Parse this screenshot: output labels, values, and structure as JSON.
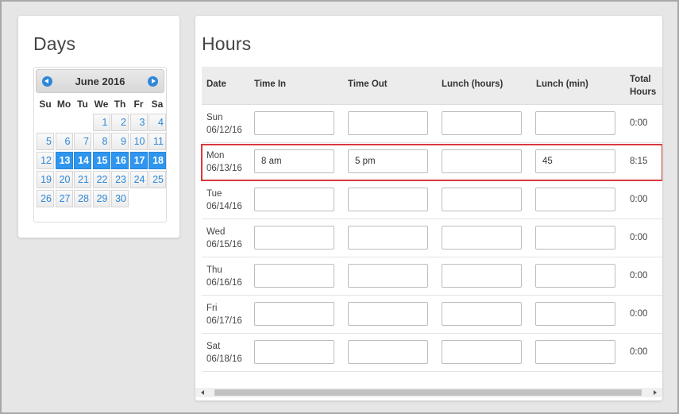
{
  "days_panel": {
    "title": "Days",
    "calendar": {
      "month_label": "June 2016",
      "weekdays": [
        "Su",
        "Mo",
        "Tu",
        "We",
        "Th",
        "Fr",
        "Sa"
      ],
      "leading_blanks": 3,
      "days": [
        "1",
        "2",
        "3",
        "4",
        "5",
        "6",
        "7",
        "8",
        "9",
        "10",
        "11",
        "12",
        "13",
        "14",
        "15",
        "16",
        "17",
        "18",
        "19",
        "20",
        "21",
        "22",
        "23",
        "24",
        "25",
        "26",
        "27",
        "28",
        "29",
        "30"
      ],
      "selected_days": [
        "13",
        "14",
        "15",
        "16",
        "17",
        "18"
      ]
    }
  },
  "hours_panel": {
    "title": "Hours",
    "headers": {
      "date": "Date",
      "time_in": "Time In",
      "time_out": "Time Out",
      "lunch_hours": "Lunch (hours)",
      "lunch_min": "Lunch (min)",
      "total_line1": "Total",
      "total_line2": "Hours"
    },
    "rows": [
      {
        "day": "Sun",
        "date": "06/12/16",
        "time_in": "",
        "time_out": "",
        "lunch_hours": "",
        "lunch_min": "",
        "total": "0:00"
      },
      {
        "day": "Mon",
        "date": "06/13/16",
        "time_in": "8 am",
        "time_out": "5 pm",
        "lunch_hours": "",
        "lunch_min": "45",
        "total": "8:15"
      },
      {
        "day": "Tue",
        "date": "06/14/16",
        "time_in": "",
        "time_out": "",
        "lunch_hours": "",
        "lunch_min": "",
        "total": "0:00"
      },
      {
        "day": "Wed",
        "date": "06/15/16",
        "time_in": "",
        "time_out": "",
        "lunch_hours": "",
        "lunch_min": "",
        "total": "0:00"
      },
      {
        "day": "Thu",
        "date": "06/16/16",
        "time_in": "",
        "time_out": "",
        "lunch_hours": "",
        "lunch_min": "",
        "total": "0:00"
      },
      {
        "day": "Fri",
        "date": "06/17/16",
        "time_in": "",
        "time_out": "",
        "lunch_hours": "",
        "lunch_min": "",
        "total": "0:00"
      },
      {
        "day": "Sat",
        "date": "06/18/16",
        "time_in": "",
        "time_out": "",
        "lunch_hours": "",
        "lunch_min": "",
        "total": "0:00"
      }
    ],
    "highlighted_row": 1
  },
  "colors": {
    "accent": "#2f96ef",
    "highlight_border": "#d9393e",
    "link_blue": "#2e87d8"
  },
  "icons": [
    "chevron-left-icon",
    "chevron-right-icon"
  ]
}
